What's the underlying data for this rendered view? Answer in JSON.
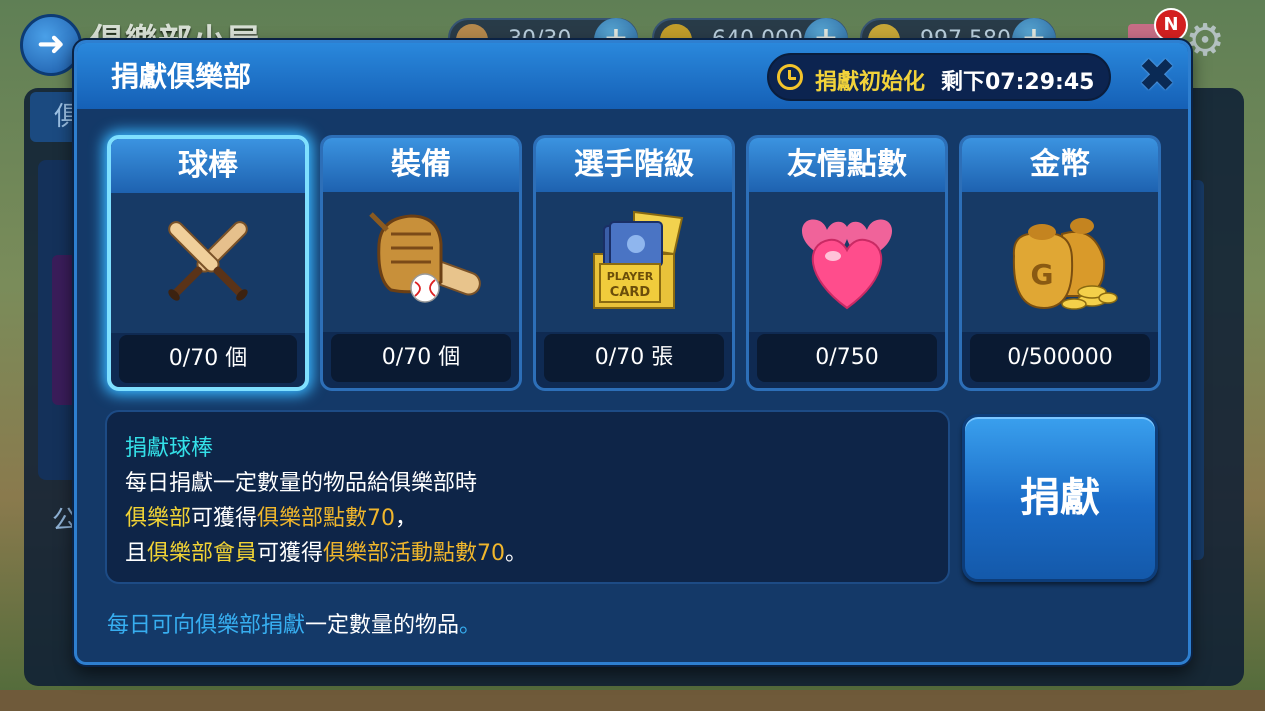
{
  "background": {
    "title": "俱樂部小屋",
    "resources": [
      "30/30",
      "640,000",
      "997,580"
    ],
    "tab_label": "俱",
    "side_label": "公",
    "notification_badge": "N"
  },
  "dialog": {
    "title": "捐獻俱樂部",
    "timer_label": "捐獻初始化",
    "timer_value": "剩下07:29:45"
  },
  "items": [
    {
      "label": "球棒",
      "count": "0/70 個",
      "icon": "baseball-bats-icon"
    },
    {
      "label": "裝備",
      "count": "0/70 個",
      "icon": "glove-bat-icon"
    },
    {
      "label": "選手階級",
      "count": "0/70 張",
      "icon": "player-card-box-icon"
    },
    {
      "label": "友情點數",
      "count": "0/750",
      "icon": "hearts-icon"
    },
    {
      "label": "金幣",
      "count": "0/500000",
      "icon": "gold-coin-bags-icon"
    }
  ],
  "selected_item": 0,
  "description": {
    "title": "捐獻球棒",
    "line1": "每日捐獻一定數量的物品給俱樂部時",
    "line2_a": "俱樂部",
    "line2_b": "可獲得",
    "line2_c": "俱樂部點數70",
    "line2_d": "，",
    "line3_a": "且",
    "line3_b": "俱樂部會員",
    "line3_c": "可獲得",
    "line3_d": "俱樂部活動點數70",
    "line3_e": "。"
  },
  "donate_button": "捐獻",
  "footer": {
    "part_a": "每日可向俱樂部捐獻",
    "part_b": "一定數量的物品",
    "part_c": "。"
  },
  "colors": {
    "accent_cyan": "#34e0e8",
    "accent_yellow": "#f1d335",
    "accent_gold": "#f0b62c",
    "accent_blue": "#37aef0",
    "selected_glow": "#39b6ff"
  }
}
